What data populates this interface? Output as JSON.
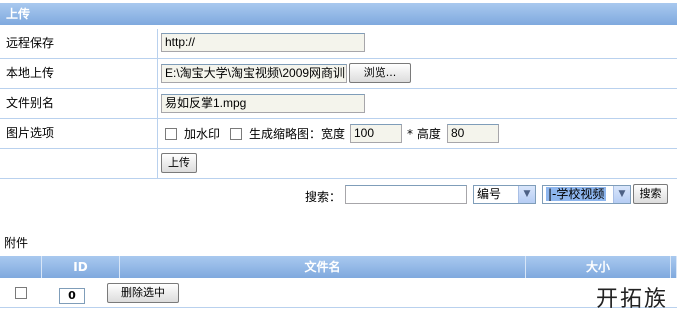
{
  "upload": {
    "header": "上传",
    "remote_save": {
      "label": "远程保存",
      "value": "http://"
    },
    "local_upload": {
      "label": "本地上传",
      "value": "E:\\淘宝大学\\淘宝视频\\2009网商训",
      "browse_label": "浏览..."
    },
    "file_alias": {
      "label": "文件别名",
      "value": "易如反掌1.mpg"
    },
    "image_options": {
      "label": "图片选项",
      "watermark_label": "加水印",
      "thumbnail_label": "生成缩略图：宽度",
      "width_value": "100",
      "height_label": "* 高度",
      "height_value": "80"
    },
    "submit_label": "上传"
  },
  "search": {
    "label": "搜索：",
    "value": "",
    "field_select": "编号",
    "category_select": "|-学校视频",
    "button_label": "搜索"
  },
  "attachments": {
    "title": "附件",
    "columns": [
      "ID",
      "文件名",
      "大小"
    ],
    "id_value": "0",
    "delete_label": "删除选中"
  },
  "watermark_text": "开拓族"
}
